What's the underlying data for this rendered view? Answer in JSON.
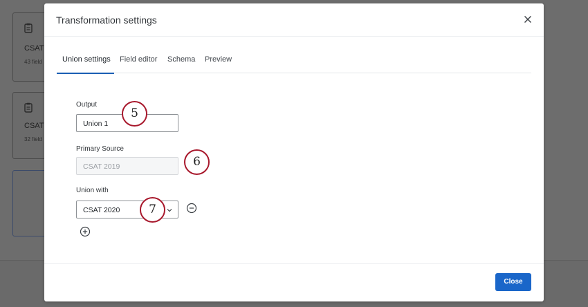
{
  "background": {
    "cards": [
      {
        "title": "CSAT",
        "subtitle": "43 field"
      },
      {
        "title": "CSAT",
        "subtitle": "32 field"
      }
    ]
  },
  "modal": {
    "title": "Transformation settings",
    "close_icon": "close-icon",
    "tabs": [
      {
        "label": "Union settings",
        "active": true
      },
      {
        "label": "Field editor",
        "active": false
      },
      {
        "label": "Schema",
        "active": false
      },
      {
        "label": "Preview",
        "active": false
      }
    ],
    "output": {
      "label": "Output",
      "value": "Union 1"
    },
    "primary_source": {
      "label": "Primary Source",
      "value": "CSAT 2019",
      "disabled": true
    },
    "union_with": {
      "label": "Union with",
      "value": "CSAT 2020"
    },
    "close_button": "Close"
  },
  "steps": [
    "5",
    "6",
    "7"
  ],
  "colors": {
    "accent": "#1a66c9",
    "step_ring": "#a8182c"
  }
}
